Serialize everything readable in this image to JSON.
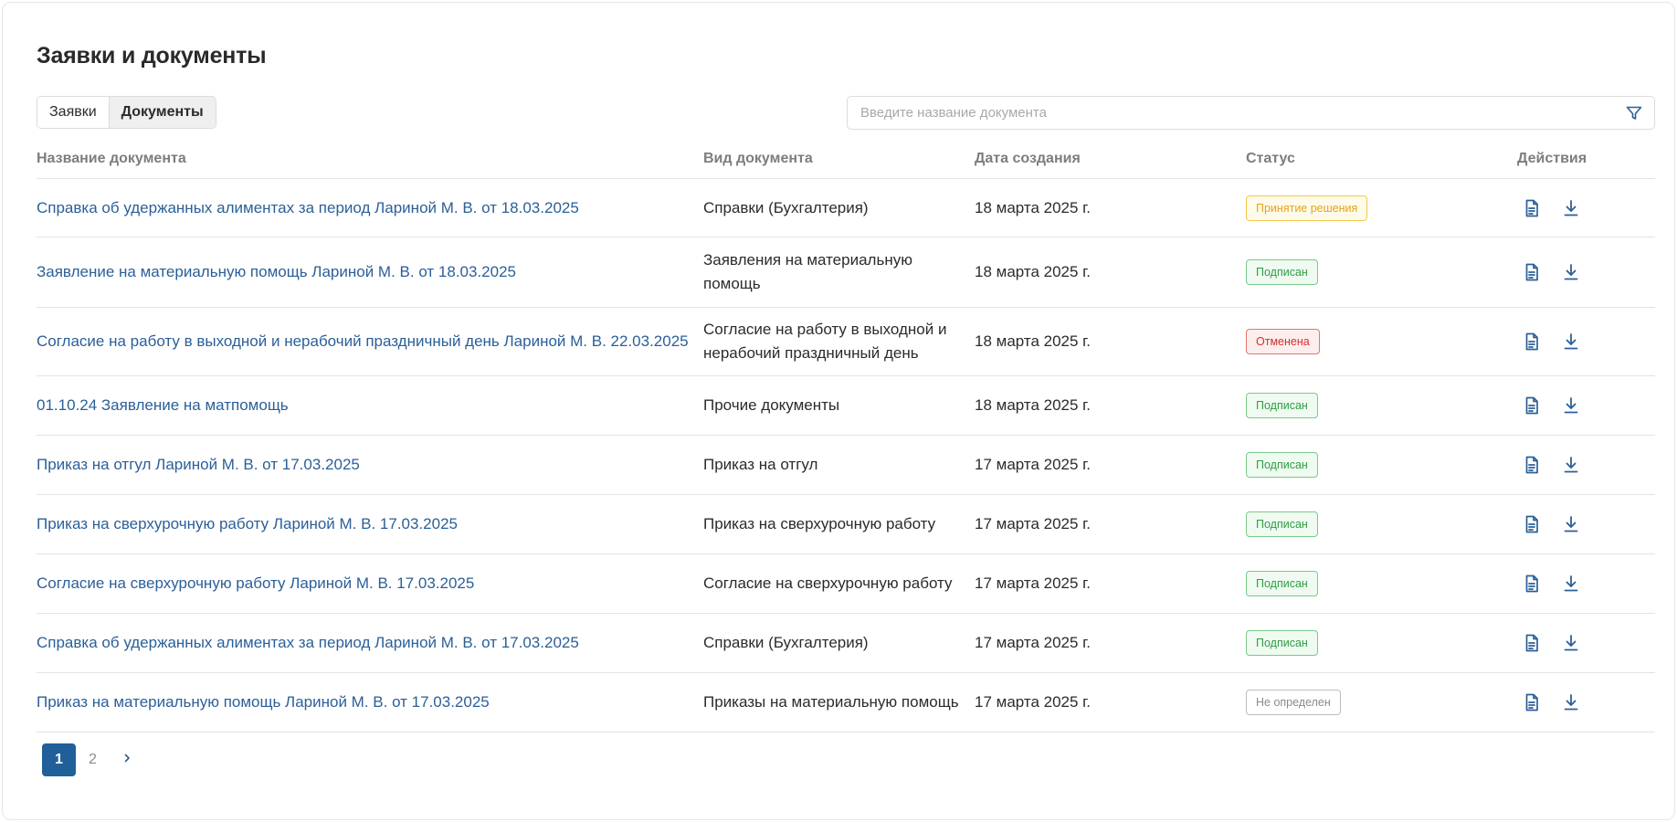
{
  "page": {
    "title": "Заявки и документы"
  },
  "tabs": [
    {
      "label": "Заявки",
      "active": false
    },
    {
      "label": "Документы",
      "active": true
    }
  ],
  "search": {
    "placeholder": "Введите название документа",
    "value": ""
  },
  "table": {
    "headers": {
      "name": "Название документа",
      "type": "Вид документа",
      "date": "Дата создания",
      "status": "Статус",
      "actions": "Действия"
    },
    "rows": [
      {
        "name": "Справка об удержанных алиментах за период Лариной М. В. от 18.03.2025",
        "type": "Справки (Бухгалтерия)",
        "date": "18 марта 2025 г.",
        "status": "Принятие решения",
        "status_kind": "pending"
      },
      {
        "name": "Заявление на материальную помощь Лариной М. В. от 18.03.2025",
        "type": "Заявления на материальную помощь",
        "date": "18 марта 2025 г.",
        "status": "Подписан",
        "status_kind": "signed"
      },
      {
        "name": "Согласие на работу в выходной и нерабочий праздничный день Лариной М. В. 22.03.2025",
        "type": "Согласие на работу в выходной и нерабочий праздничный день",
        "date": "18 марта 2025 г.",
        "status": "Отменена",
        "status_kind": "cancelled"
      },
      {
        "name": "01.10.24 Заявление на матпомощь",
        "type": "Прочие документы",
        "date": "18 марта 2025 г.",
        "status": "Подписан",
        "status_kind": "signed"
      },
      {
        "name": "Приказ на отгул Лариной М. В. от 17.03.2025",
        "type": "Приказ на отгул",
        "date": "17 марта 2025 г.",
        "status": "Подписан",
        "status_kind": "signed"
      },
      {
        "name": "Приказ на сверхурочную работу Лариной М. В. 17.03.2025",
        "type": "Приказ на сверхурочную работу",
        "date": "17 марта 2025 г.",
        "status": "Подписан",
        "status_kind": "signed"
      },
      {
        "name": "Согласие на сверхурочную работу Лариной М. В. 17.03.2025",
        "type": "Согласие на сверхурочную работу",
        "date": "17 марта 2025 г.",
        "status": "Подписан",
        "status_kind": "signed"
      },
      {
        "name": "Справка об удержанных алиментах за период Лариной М. В. от 17.03.2025",
        "type": "Справки (Бухгалтерия)",
        "date": "17 марта 2025 г.",
        "status": "Подписан",
        "status_kind": "signed"
      },
      {
        "name": "Приказ на материальную помощь Лариной М. В. от 17.03.2025",
        "type": "Приказы на материальную помощь",
        "date": "17 марта 2025 г.",
        "status": "Не определен",
        "status_kind": "undefined"
      }
    ]
  },
  "status_colors": {
    "pending": {
      "text": "#e3a41a",
      "border": "#f2c94c",
      "bg": "#fffbea"
    },
    "signed": {
      "text": "#2f9e44",
      "border": "#7bc98a",
      "bg": "#effaf1"
    },
    "cancelled": {
      "text": "#d32f2f",
      "border": "#e57373",
      "bg": "#fdeeee"
    },
    "undefined": {
      "text": "#8a8a8a",
      "border": "#bdbdbd",
      "bg": "#ffffff"
    }
  },
  "icons": {
    "filter": "filter-icon",
    "view": "document-icon",
    "download": "download-icon",
    "next": "chevron-right-icon"
  },
  "accent_color": "#205f98",
  "pagination": {
    "pages": [
      "1",
      "2"
    ],
    "current": "1"
  }
}
